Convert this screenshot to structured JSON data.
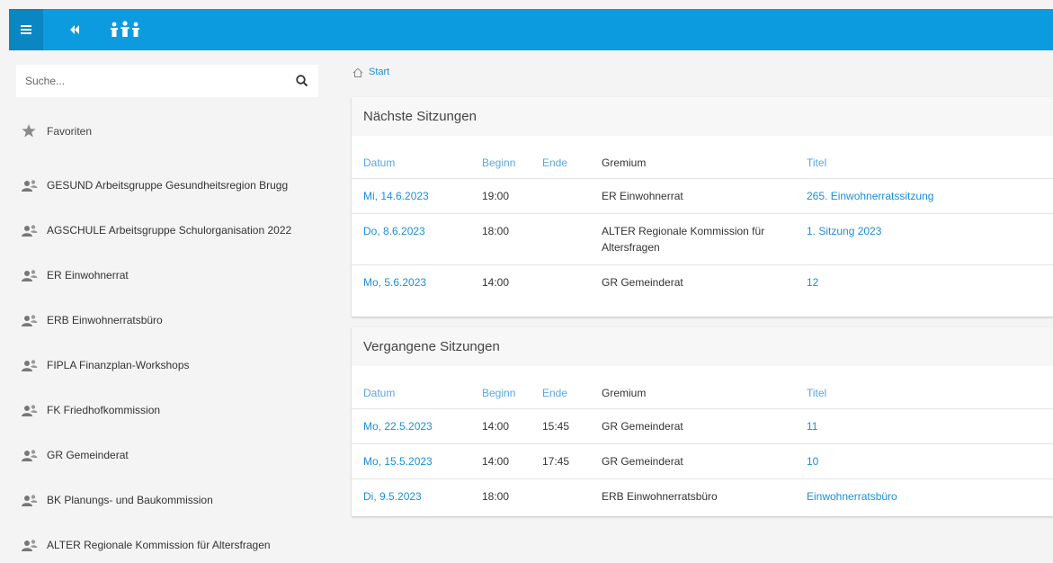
{
  "topbar": {
    "menu_icon": "hamburger-icon",
    "back_icon": "double-chevron-left-icon",
    "logo_icon": "people-group-icon",
    "color": "#0d9bdf"
  },
  "sidebar": {
    "search": {
      "placeholder": "Suche...",
      "value": ""
    },
    "favorites_label": "Favoriten",
    "items": [
      {
        "label": "GESUND Arbeitsgruppe Gesundheitsregion Brugg"
      },
      {
        "label": "AGSCHULE Arbeitsgruppe Schulorganisation 2022"
      },
      {
        "label": "ER Einwohnerrat"
      },
      {
        "label": "ERB Einwohnerratsbüro"
      },
      {
        "label": "FIPLA Finanzplan-Workshops"
      },
      {
        "label": "FK Friedhofkommission"
      },
      {
        "label": "GR Gemeinderat"
      },
      {
        "label": "BK Planungs- und Baukommission"
      },
      {
        "label": "ALTER Regionale Kommission für Altersfragen"
      }
    ]
  },
  "breadcrumb": {
    "label": "Start"
  },
  "columns": {
    "datum": "Datum",
    "beginn": "Beginn",
    "ende": "Ende",
    "gremium": "Gremium",
    "titel": "Titel"
  },
  "next": {
    "title": "Nächste Sitzungen",
    "rows": [
      {
        "datum": "Mi, 14.6.2023",
        "beginn": "19:00",
        "ende": "",
        "gremium": "ER Einwohnerrat",
        "titel": "265. Einwohnerratssitzung"
      },
      {
        "datum": "Do, 8.6.2023",
        "beginn": "18:00",
        "ende": "",
        "gremium": "ALTER Regionale Kommission für Altersfragen",
        "titel": "1. Sitzung 2023"
      },
      {
        "datum": "Mo, 5.6.2023",
        "beginn": "14:00",
        "ende": "",
        "gremium": "GR Gemeinderat",
        "titel": "12"
      }
    ]
  },
  "past": {
    "title": "Vergangene Sitzungen",
    "rows": [
      {
        "datum": "Mo, 22.5.2023",
        "beginn": "14:00",
        "ende": "15:45",
        "gremium": "GR Gemeinderat",
        "titel": "11"
      },
      {
        "datum": "Mo, 15.5.2023",
        "beginn": "14:00",
        "ende": "17:45",
        "gremium": "GR Gemeinderat",
        "titel": "10"
      },
      {
        "datum": "Di, 9.5.2023",
        "beginn": "18:00",
        "ende": "",
        "gremium": "ERB Einwohnerratsbüro",
        "titel": "Einwohnerratsbüro"
      }
    ]
  }
}
